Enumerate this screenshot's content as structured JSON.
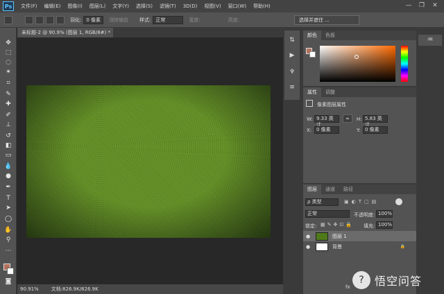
{
  "app": {
    "logo": "Ps"
  },
  "menu": [
    "文件(F)",
    "编辑(E)",
    "图像(I)",
    "图层(L)",
    "文字(Y)",
    "选择(S)",
    "滤镜(T)",
    "3D(D)",
    "视图(V)",
    "窗口(W)",
    "帮助(H)"
  ],
  "window_controls": {
    "minimize": "—",
    "restore": "❐",
    "close": "✕"
  },
  "options": {
    "feather_label": "羽化:",
    "feather_value": "0 像素",
    "antialias_label": "消除锯齿",
    "style_label": "样式:",
    "style_value": "正常",
    "width_label": "宽度:",
    "height_label": "高度:",
    "select_mask_button": "选择并遮住 ..."
  },
  "document": {
    "tab_title": "未标题-2 @ 90.9% (图层 1, RGB/8#) *",
    "close_glyph": "×"
  },
  "status": {
    "zoom": "90.91%",
    "doc_info": "文档:826.9K/826.9K"
  },
  "panels": {
    "color_tabs": [
      "颜色",
      "色板"
    ],
    "properties_tabs": [
      "属性",
      "调整"
    ],
    "properties_title": "像素图层属性",
    "W_label": "W:",
    "W_value": "9.33 英寸",
    "H_label": "H:",
    "H_value": "5.83 英寸",
    "X_label": "X:",
    "X_value": "0 像素",
    "Y_label": "Y:",
    "Y_value": "0 像素",
    "layers_tabs": [
      "图层",
      "通道",
      "路径"
    ],
    "filter_kind": "ρ 类型",
    "blend_mode": "正常",
    "opacity_label": "不透明度:",
    "opacity_value": "100%",
    "lock_label": "锁定:",
    "fill_label": "填充:",
    "fill_value": "100%",
    "footer_icons": "fx"
  },
  "layers": [
    {
      "name": "图层 1",
      "selected": true,
      "eye": "●"
    },
    {
      "name": "背景",
      "selected": false,
      "eye": "●",
      "lock": "🔒"
    }
  ],
  "colors": {
    "foreground": "#b3715a",
    "background": "#ffffff"
  },
  "watermark": {
    "icon": "?",
    "text": "悟空问答"
  }
}
